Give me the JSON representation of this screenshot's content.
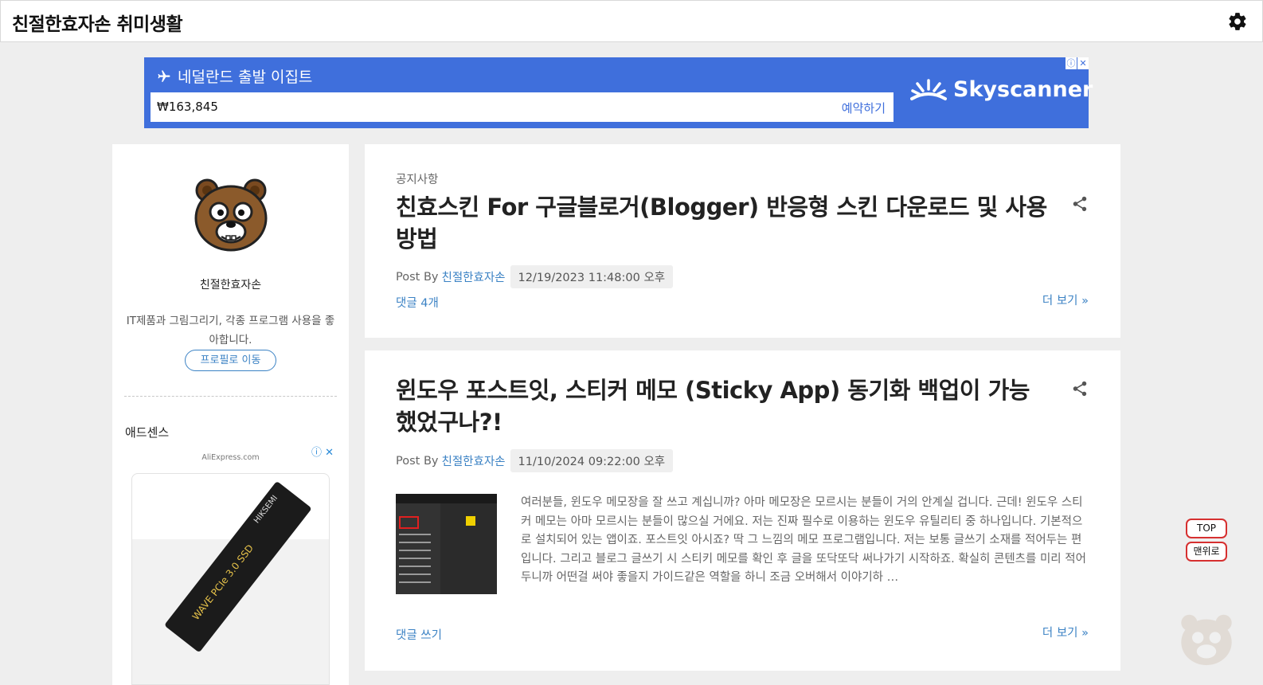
{
  "header": {
    "site_title": "친절한효자손 취미생활"
  },
  "ad_banner": {
    "title": "네덜란드 출발 이집트",
    "price": "₩163,845",
    "cta": "예약하기",
    "brand": "Skyscanner",
    "brand_color": "#3f6fdc"
  },
  "sidebar": {
    "author_name": "친절한효자손",
    "author_desc": "IT제품과 그림그리기, 각종 프로그램 사용을 좋아합니다.",
    "profile_button": "프로필로 이동",
    "widget_title": "애드센스",
    "ad_source": "AliExpress.com",
    "ad_product_text": "WAVE PCIe 3.0 SSD",
    "ad_product_brand": "HIKSEMI"
  },
  "posts": [
    {
      "label": "공지사항",
      "title": "친효스킨 For 구글블로거(Blogger) 반응형 스킨 다운로드 및 사용 방법",
      "post_by": "Post By",
      "author": "친절한효자손",
      "date": "12/19/2023 11:48:00 오후",
      "comments": "댓글 4개",
      "more": "더 보기 »"
    },
    {
      "title": "윈도우 포스트잇, 스티커 메모 (Sticky App) 동기화 백업이 가능했었구나?!",
      "post_by": "Post By",
      "author": "친절한효자손",
      "date": "11/10/2024 09:22:00 오후",
      "excerpt": "여러분들, 윈도우 메모장을 잘 쓰고 계십니까? 아마 메모장은 모르시는 분들이 거의 안계실 겁니다. 근데! 윈도우 스티커 메모는 아마 모르시는 분들이 많으실 거에요. 저는 진짜 필수로 이용하는 윈도우 유틸리티 중 하나입니다. 기본적으로 설치되어 있는 앱이죠. 포스트잇 아시죠? 딱 그 느낌의 메모 프로그램입니다. 저는 보통 글쓰기 소재를 적어두는 편입니다. 그리고 블로그 글쓰기 시 스티키 메모를 확인 후 글을 또닥또닥 써나가기 시작하죠. 확실히 콘텐츠를 미리 적어두니까 어떤걸 써야 좋을지 가이드같은 역할을 하니 조금 오버해서 이야기하 …",
      "comments": "댓글 쓰기",
      "more": "더 보기 »"
    }
  ],
  "floating": {
    "top": "TOP",
    "home": "맨위로"
  },
  "colors": {
    "link": "#3b82c4",
    "accent_red": "#d63030"
  },
  "icons": {
    "settings": "gear-icon",
    "share": "share-icon",
    "airplane": "airplane-icon",
    "adchoices": "adchoices-icon",
    "close": "close-icon"
  }
}
